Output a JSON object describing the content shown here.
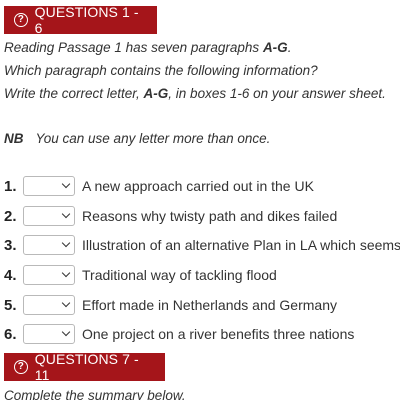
{
  "sections": {
    "first": {
      "header": "QUESTIONS 1 - 6",
      "instructions": {
        "line1_pre": "Reading Passage 1 has seven paragraphs ",
        "line1_bold": "A-G",
        "line1_post": ".",
        "line2": "Which paragraph contains the following information?",
        "line3_pre": "Write the correct letter, ",
        "line3_bold": "A-G",
        "line3_post": ", in boxes 1-6 on your answer sheet."
      },
      "nb_label": "NB",
      "nb_text": "You can use any letter more than once.",
      "questions": [
        {
          "number": "1.",
          "selected": "",
          "text": "A new approach carried out in the UK"
        },
        {
          "number": "2.",
          "selected": "",
          "text": "Reasons why twisty path and dikes failed"
        },
        {
          "number": "3.",
          "selected": "",
          "text": "Illustration of an alternative Plan in LA which seems"
        },
        {
          "number": "4.",
          "selected": "",
          "text": "Traditional way of tackling flood"
        },
        {
          "number": "5.",
          "selected": "",
          "text": "Effort made in Netherlands and Germany"
        },
        {
          "number": "6.",
          "selected": "",
          "text": "One project on a river benefits three nations"
        }
      ]
    },
    "second": {
      "header": "QUESTIONS 7 - 11",
      "instruction": "Complete the summary below."
    }
  },
  "icons": {
    "header_icon": "help-circle-icon",
    "select_icon": "chevron-down-icon"
  },
  "colors": {
    "header_bg": "#a5151a",
    "header_text": "#ffffff"
  }
}
